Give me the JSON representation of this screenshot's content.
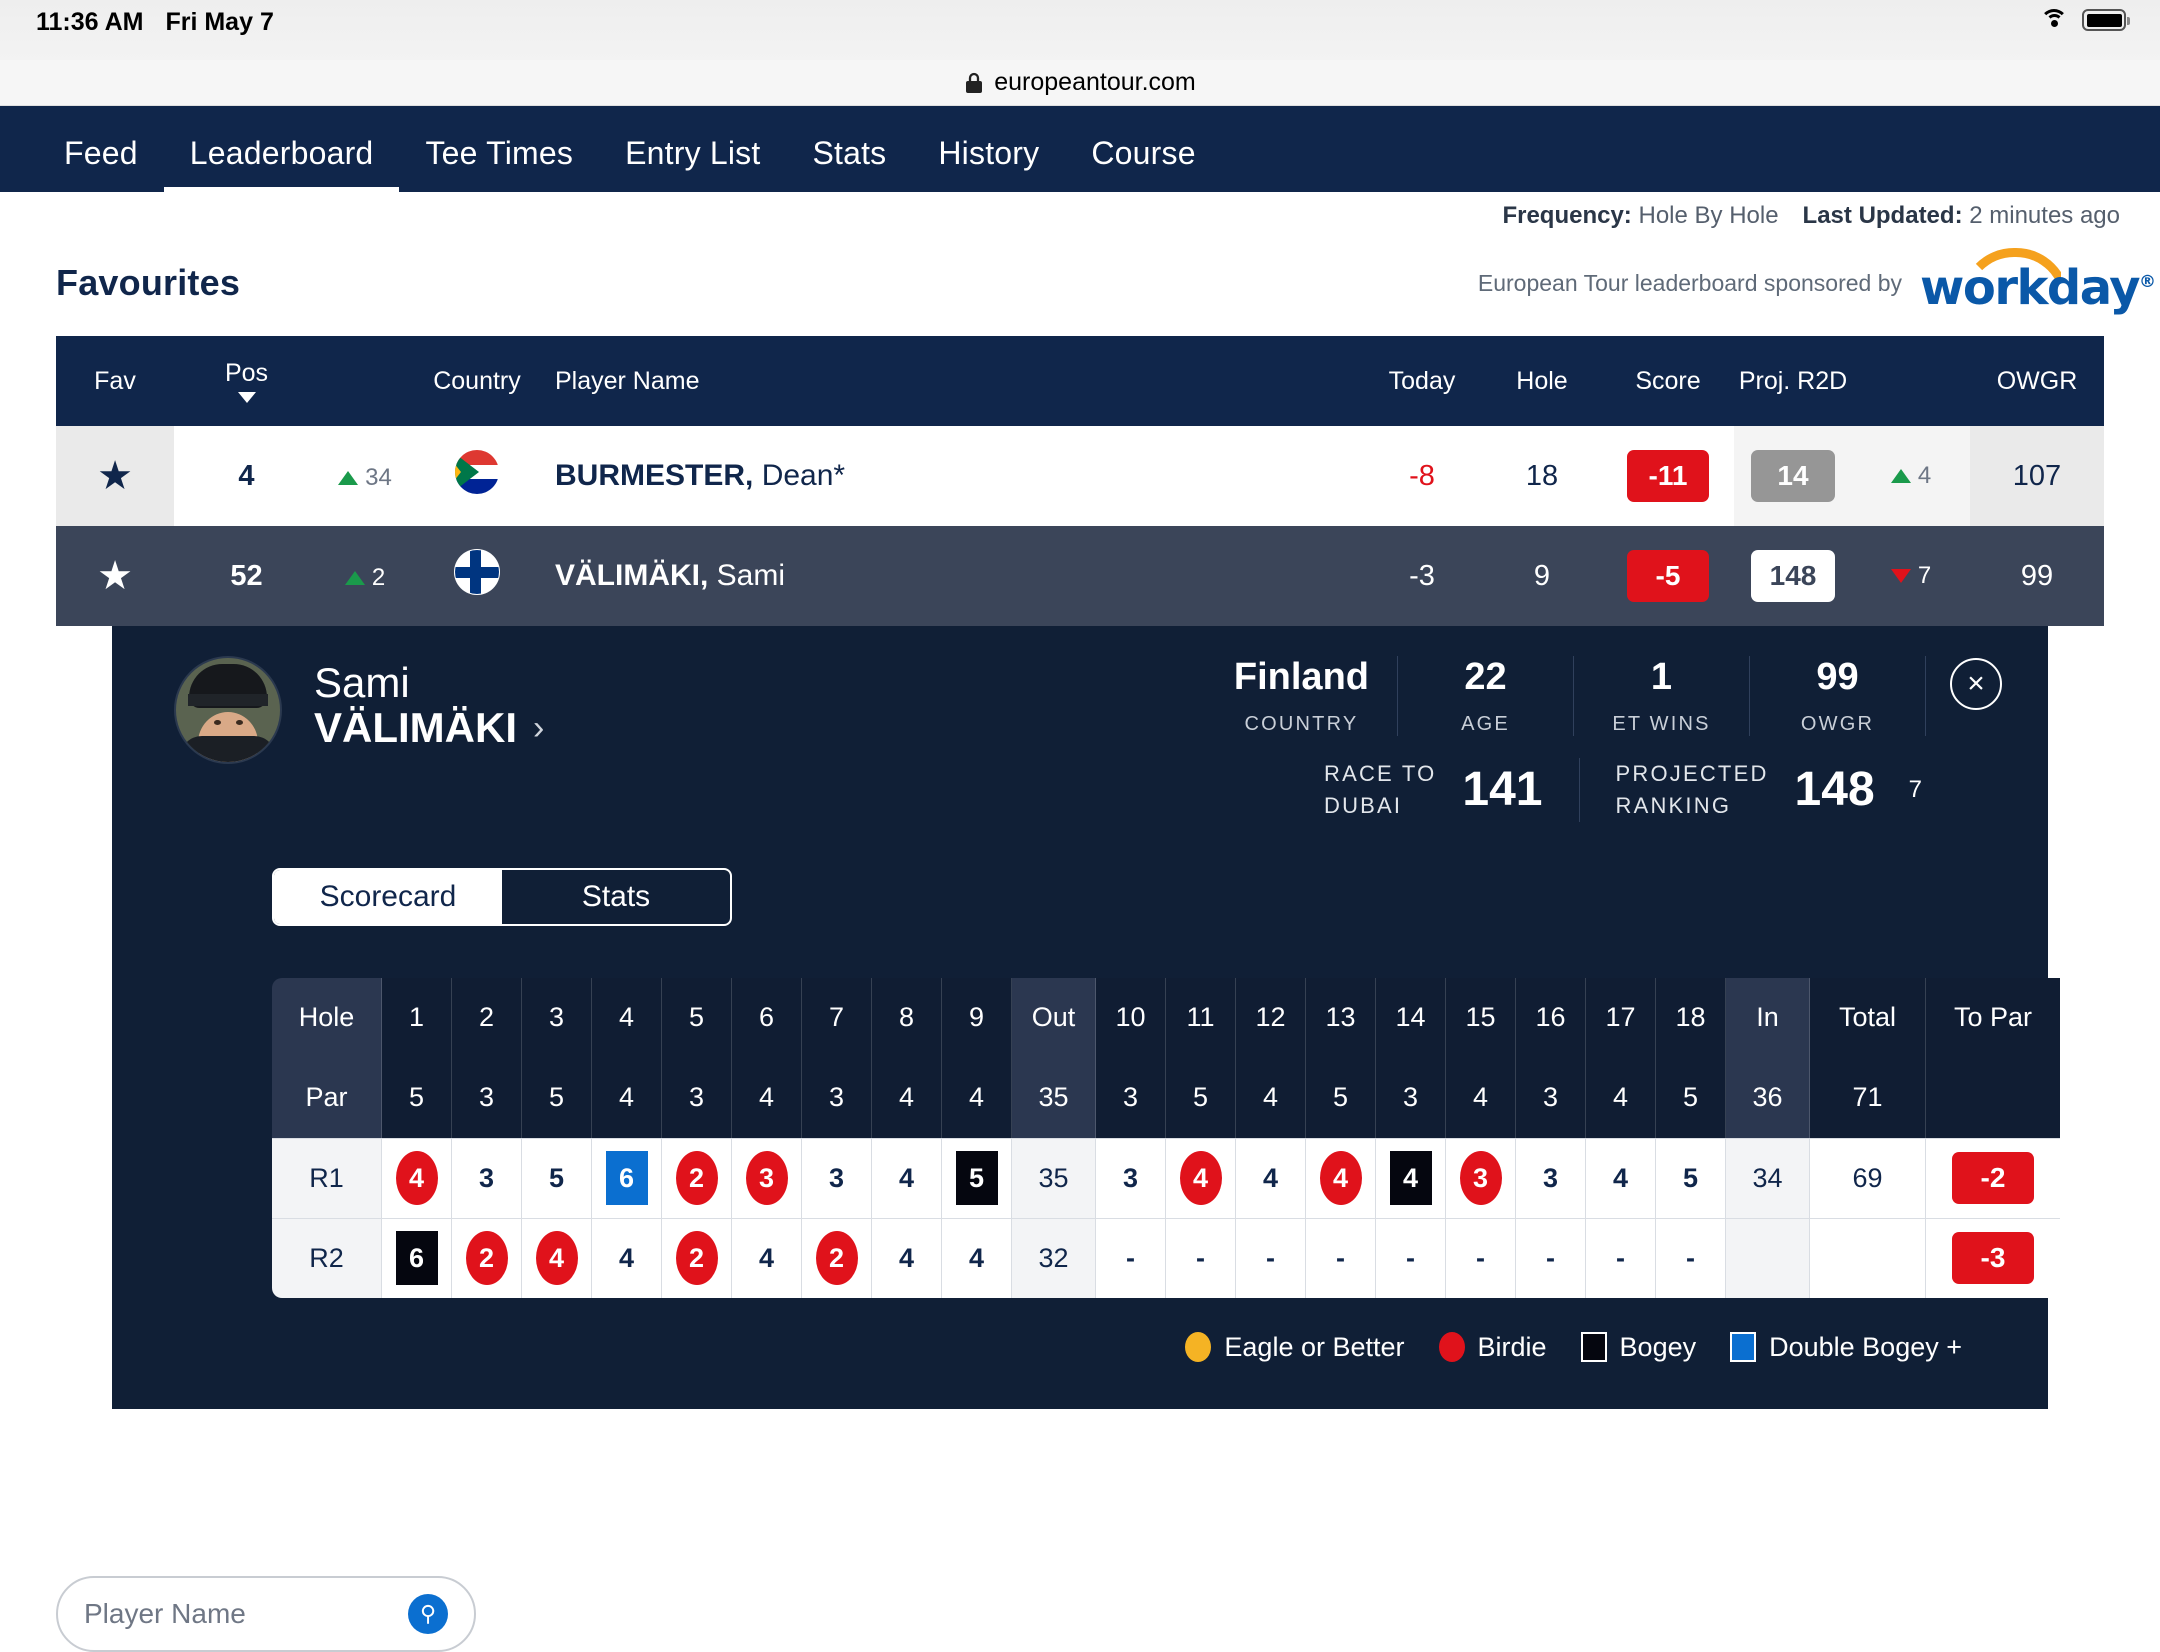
{
  "status_bar": {
    "time": "11:36 AM",
    "date": "Fri May 7",
    "wifi_icon": "wifi-icon",
    "battery_icon": "battery-icon"
  },
  "browser": {
    "lock_icon": "\u0001",
    "url": "europeantour.com"
  },
  "nav": {
    "tabs": [
      {
        "label": "Feed",
        "active": false
      },
      {
        "label": "Leaderboard",
        "active": true
      },
      {
        "label": "Tee Times",
        "active": false
      },
      {
        "label": "Entry List",
        "active": false
      },
      {
        "label": "Stats",
        "active": false
      },
      {
        "label": "History",
        "active": false
      },
      {
        "label": "Course",
        "active": false
      }
    ]
  },
  "meta": {
    "frequency_label": "Frequency:",
    "frequency_value": "Hole By Hole",
    "updated_label": "Last Updated:",
    "updated_value": "2 minutes ago"
  },
  "favourites": {
    "title": "Favourites",
    "sponsor_text": "European Tour leaderboard sponsored by",
    "sponsor_brand": "workday",
    "sponsor_reg": "®"
  },
  "table": {
    "headers": {
      "fav": "Fav",
      "pos": "Pos",
      "country": "Country",
      "player_name": "Player Name",
      "today": "Today",
      "hole": "Hole",
      "score": "Score",
      "proj_r2d": "Proj. R2D",
      "owgr": "OWGR"
    },
    "rows": [
      {
        "fav_icon": "star-filled-icon",
        "pos": "4",
        "move_dir": "up",
        "move": "34",
        "country_flag": "flag-south-africa",
        "surname": "BURMESTER,",
        "given": "Dean*",
        "today": "-8",
        "hole": "18",
        "score": "-11",
        "proj_r2d": "14",
        "r2d_move_dir": "up",
        "r2d_move": "4",
        "owgr": "107",
        "selected": false
      },
      {
        "fav_icon": "star-filled-icon",
        "pos": "52",
        "move_dir": "up",
        "move": "2",
        "country_flag": "flag-finland",
        "surname": "VÄLIMÄKI,",
        "given": "Sami",
        "today": "-3",
        "hole": "9",
        "score": "-5",
        "proj_r2d": "148",
        "r2d_move_dir": "down",
        "r2d_move": "7",
        "owgr": "99",
        "selected": true
      }
    ]
  },
  "player_panel": {
    "avatar_alt": "player-avatar",
    "first_name": "Sami",
    "last_name": "VÄLIMÄKI",
    "chevron": "›",
    "close_icon": "×",
    "stats": [
      {
        "value": "Finland",
        "label": "COUNTRY"
      },
      {
        "value": "22",
        "label": "AGE"
      },
      {
        "value": "1",
        "label": "ET WINS"
      },
      {
        "value": "99",
        "label": "OWGR"
      }
    ],
    "big_stats": [
      {
        "label": "RACE TO\nDUBAI",
        "label_line1": "RACE TO",
        "label_line2": "DUBAI",
        "value": "141",
        "delta": "",
        "delta_dir": ""
      },
      {
        "label": "PROJECTED\nRANKING",
        "label_line1": "PROJECTED",
        "label_line2": "RANKING",
        "value": "148",
        "delta": "7",
        "delta_dir": "down"
      }
    ],
    "tabs": [
      {
        "label": "Scorecard",
        "active": true
      },
      {
        "label": "Stats",
        "active": false
      }
    ]
  },
  "scorecard": {
    "row_labels": {
      "hole": "Hole",
      "par": "Par",
      "r1": "R1",
      "r2": "R2"
    },
    "col_labels": {
      "out": "Out",
      "in": "In",
      "total": "Total",
      "to_par": "To Par"
    },
    "holes": [
      "1",
      "2",
      "3",
      "4",
      "5",
      "6",
      "7",
      "8",
      "9"
    ],
    "holes_back": [
      "10",
      "11",
      "12",
      "13",
      "14",
      "15",
      "16",
      "17",
      "18"
    ],
    "par_front": [
      "5",
      "3",
      "5",
      "4",
      "3",
      "4",
      "3",
      "4",
      "4"
    ],
    "par_out": "35",
    "par_back": [
      "3",
      "5",
      "4",
      "5",
      "3",
      "4",
      "3",
      "4",
      "5"
    ],
    "par_in": "36",
    "par_total": "71",
    "rounds": [
      {
        "label": "R1",
        "front": [
          {
            "v": "4",
            "m": "birdie"
          },
          {
            "v": "3",
            "m": "plain"
          },
          {
            "v": "5",
            "m": "plain"
          },
          {
            "v": "6",
            "m": "dblbogey"
          },
          {
            "v": "2",
            "m": "birdie"
          },
          {
            "v": "3",
            "m": "birdie"
          },
          {
            "v": "3",
            "m": "plain"
          },
          {
            "v": "4",
            "m": "plain"
          },
          {
            "v": "5",
            "m": "bogey"
          }
        ],
        "out": "35",
        "back": [
          {
            "v": "3",
            "m": "plain"
          },
          {
            "v": "4",
            "m": "birdie"
          },
          {
            "v": "4",
            "m": "plain"
          },
          {
            "v": "4",
            "m": "birdie"
          },
          {
            "v": "4",
            "m": "bogey"
          },
          {
            "v": "3",
            "m": "birdie"
          },
          {
            "v": "3",
            "m": "plain"
          },
          {
            "v": "4",
            "m": "plain"
          },
          {
            "v": "5",
            "m": "plain"
          }
        ],
        "in": "34",
        "total": "69",
        "to_par": "-2"
      },
      {
        "label": "R2",
        "front": [
          {
            "v": "6",
            "m": "bogey"
          },
          {
            "v": "2",
            "m": "birdie"
          },
          {
            "v": "4",
            "m": "birdie"
          },
          {
            "v": "4",
            "m": "plain"
          },
          {
            "v": "2",
            "m": "birdie"
          },
          {
            "v": "4",
            "m": "plain"
          },
          {
            "v": "2",
            "m": "birdie"
          },
          {
            "v": "4",
            "m": "plain"
          },
          {
            "v": "4",
            "m": "plain"
          }
        ],
        "out": "32",
        "back": [
          {
            "v": "-",
            "m": "plain"
          },
          {
            "v": "-",
            "m": "plain"
          },
          {
            "v": "-",
            "m": "plain"
          },
          {
            "v": "-",
            "m": "plain"
          },
          {
            "v": "-",
            "m": "plain"
          },
          {
            "v": "-",
            "m": "plain"
          },
          {
            "v": "-",
            "m": "plain"
          },
          {
            "v": "-",
            "m": "plain"
          },
          {
            "v": "-",
            "m": "plain"
          }
        ],
        "in": "",
        "total": "",
        "to_par": "-3"
      }
    ],
    "legend": [
      {
        "label": "Eagle or Better",
        "shape": "circle",
        "color": "#f5b324"
      },
      {
        "label": "Birdie",
        "shape": "circle",
        "color": "#e0121b"
      },
      {
        "label": "Bogey",
        "shape": "square",
        "color": "#05060f"
      },
      {
        "label": "Double Bogey +",
        "shape": "square",
        "color": "#0b6fd0"
      }
    ]
  },
  "bottom_search": {
    "placeholder": "Player Name",
    "search_icon": "search-icon"
  },
  "colors": {
    "navy": "#10264b",
    "panel_navy": "#101f36",
    "red": "#e0121b",
    "green": "#1a9a4b",
    "blue": "#0b6fd0",
    "amber": "#f5b324"
  }
}
